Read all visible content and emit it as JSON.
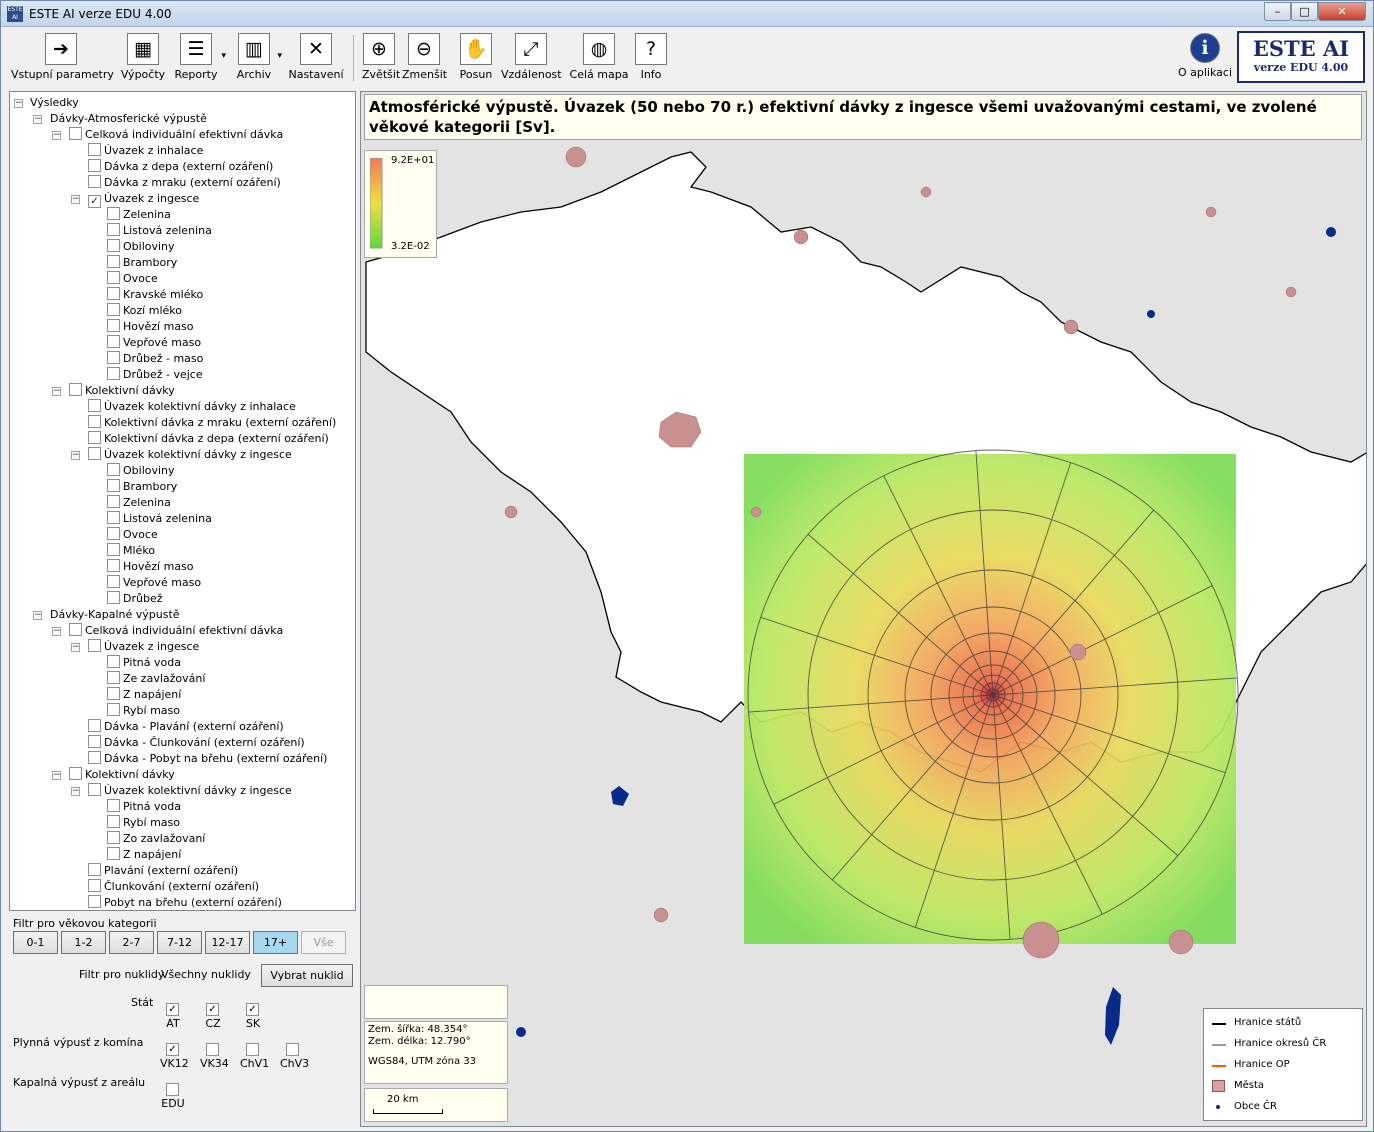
{
  "window": {
    "title": "ESTE AI verze EDU 4.00",
    "icon_text": "ESTE AI"
  },
  "toolbar": {
    "items": [
      {
        "label": "Vstupní parametry",
        "icon": "enter-icon",
        "glyph": "➔"
      },
      {
        "label": "Výpočty",
        "icon": "calculator-icon",
        "glyph": "▦"
      },
      {
        "label": "Reporty",
        "icon": "report-icon",
        "glyph": "☰"
      },
      {
        "label": "Archiv",
        "icon": "archive-icon",
        "glyph": "▥"
      },
      {
        "label": "Nastavení",
        "icon": "tools-icon",
        "glyph": "✕"
      },
      {
        "label": "Zvětšit",
        "icon": "zoom-in-icon",
        "glyph": "⊕"
      },
      {
        "label": "Zmenšit",
        "icon": "zoom-out-icon",
        "glyph": "⊖"
      },
      {
        "label": "Posun",
        "icon": "hand-icon",
        "glyph": "✋"
      },
      {
        "label": "Vzdálenost",
        "icon": "distance-icon",
        "glyph": "⤢"
      },
      {
        "label": "Celá mapa",
        "icon": "globe-icon",
        "glyph": "◍"
      },
      {
        "label": "Info",
        "icon": "info-map-icon",
        "glyph": "?"
      }
    ],
    "about_label": "O aplikaci",
    "brand_title": "ESTE AI",
    "brand_sub": "verze EDU 4.00"
  },
  "tree": {
    "items": [
      {
        "label": "Výsledky",
        "level": 0,
        "exp": "minus",
        "cb": false
      },
      {
        "label": "Dávky-Atmosferické výpustě",
        "level": 1,
        "exp": "minus",
        "cb": false
      },
      {
        "label": "Celková individuální efektivní dávka",
        "level": 2,
        "exp": "minus",
        "cb": true,
        "checked": false
      },
      {
        "label": "Úvazek z inhalace",
        "level": 3,
        "cb": true,
        "checked": false
      },
      {
        "label": "Dávka z depa (externí ozáření)",
        "level": 3,
        "cb": true,
        "checked": false
      },
      {
        "label": "Dávka z mraku (externí ozáření)",
        "level": 3,
        "cb": true,
        "checked": false
      },
      {
        "label": "Úvazek z ingesce",
        "level": 3,
        "exp": "minus",
        "cb": true,
        "checked": true
      },
      {
        "label": "Zelenina",
        "level": 4,
        "cb": true,
        "checked": false
      },
      {
        "label": "Listová zelenina",
        "level": 4,
        "cb": true,
        "checked": false
      },
      {
        "label": "Obiloviny",
        "level": 4,
        "cb": true,
        "checked": false
      },
      {
        "label": "Brambory",
        "level": 4,
        "cb": true,
        "checked": false
      },
      {
        "label": "Ovoce",
        "level": 4,
        "cb": true,
        "checked": false
      },
      {
        "label": "Kravské mléko",
        "level": 4,
        "cb": true,
        "checked": false
      },
      {
        "label": "Kozí mléko",
        "level": 4,
        "cb": true,
        "checked": false
      },
      {
        "label": "Hovězí maso",
        "level": 4,
        "cb": true,
        "checked": false
      },
      {
        "label": "Vepřové maso",
        "level": 4,
        "cb": true,
        "checked": false
      },
      {
        "label": "Drůbež - maso",
        "level": 4,
        "cb": true,
        "checked": false
      },
      {
        "label": "Drůbež - vejce",
        "level": 4,
        "cb": true,
        "checked": false
      },
      {
        "label": "Kolektivní dávky",
        "level": 2,
        "exp": "minus",
        "cb": true,
        "checked": false
      },
      {
        "label": "Úvazek kolektivní dávky z inhalace",
        "level": 3,
        "cb": true,
        "checked": false
      },
      {
        "label": "Kolektivní dávka z mraku (externí ozáření)",
        "level": 3,
        "cb": true,
        "checked": false
      },
      {
        "label": "Kolektivní dávka z depa (externí ozáření)",
        "level": 3,
        "cb": true,
        "checked": false
      },
      {
        "label": "Úvazek kolektivní dávky z ingesce",
        "level": 3,
        "exp": "minus",
        "cb": true,
        "checked": false
      },
      {
        "label": "Obiloviny",
        "level": 4,
        "cb": true,
        "checked": false
      },
      {
        "label": "Brambory",
        "level": 4,
        "cb": true,
        "checked": false
      },
      {
        "label": "Zelenina",
        "level": 4,
        "cb": true,
        "checked": false
      },
      {
        "label": "Listová zelenina",
        "level": 4,
        "cb": true,
        "checked": false
      },
      {
        "label": "Ovoce",
        "level": 4,
        "cb": true,
        "checked": false
      },
      {
        "label": "Mléko",
        "level": 4,
        "cb": true,
        "checked": false
      },
      {
        "label": "Hovězí maso",
        "level": 4,
        "cb": true,
        "checked": false
      },
      {
        "label": "Vepřové maso",
        "level": 4,
        "cb": true,
        "checked": false
      },
      {
        "label": "Drůbež",
        "level": 4,
        "cb": true,
        "checked": false
      },
      {
        "label": "Dávky-Kapalné výpustě",
        "level": 1,
        "exp": "minus",
        "cb": false
      },
      {
        "label": "Celková individuální efektivní dávka",
        "level": 2,
        "exp": "minus",
        "cb": true,
        "checked": false
      },
      {
        "label": "Úvazek z ingesce",
        "level": 3,
        "exp": "minus",
        "cb": true,
        "checked": false
      },
      {
        "label": "Pitná voda",
        "level": 4,
        "cb": true,
        "checked": false
      },
      {
        "label": "Ze zavlažování",
        "level": 4,
        "cb": true,
        "checked": false
      },
      {
        "label": "Z napájení",
        "level": 4,
        "cb": true,
        "checked": false
      },
      {
        "label": "Rybí maso",
        "level": 4,
        "cb": true,
        "checked": false
      },
      {
        "label": "Dávka - Plavání (externí ozáření)",
        "level": 3,
        "cb": true,
        "checked": false
      },
      {
        "label": "Dávka - Člunkování (externí ozáření)",
        "level": 3,
        "cb": true,
        "checked": false
      },
      {
        "label": "Dávka - Pobyt na břehu (externí ozáření)",
        "level": 3,
        "cb": true,
        "checked": false
      },
      {
        "label": "Kolektivní dávky",
        "level": 2,
        "exp": "minus",
        "cb": true,
        "checked": false
      },
      {
        "label": "Úvazek kolektivní dávky z ingesce",
        "level": 3,
        "exp": "minus",
        "cb": true,
        "checked": false
      },
      {
        "label": "Pitná voda",
        "level": 4,
        "cb": true,
        "checked": false
      },
      {
        "label": "Rybí maso",
        "level": 4,
        "cb": true,
        "checked": false
      },
      {
        "label": "Zo zavlažovaní",
        "level": 4,
        "cb": true,
        "checked": false
      },
      {
        "label": "Z napájení",
        "level": 4,
        "cb": true,
        "checked": false
      },
      {
        "label": "Plavání (externí ozáření)",
        "level": 3,
        "cb": true,
        "checked": false
      },
      {
        "label": "Člunkování (externí ozáření)",
        "level": 3,
        "cb": true,
        "checked": false
      },
      {
        "label": "Pobyt na břehu (externí ozáření)",
        "level": 3,
        "cb": true,
        "checked": false
      }
    ]
  },
  "filters": {
    "age_label": "Filtr pro věkovou kategorii",
    "ages": [
      {
        "label": "0-1",
        "state": "normal"
      },
      {
        "label": "1-2",
        "state": "normal"
      },
      {
        "label": "2-7",
        "state": "normal"
      },
      {
        "label": "7-12",
        "state": "normal"
      },
      {
        "label": "12-17",
        "state": "normal"
      },
      {
        "label": "17+",
        "state": "on"
      },
      {
        "label": "Vše",
        "state": "off"
      }
    ],
    "nuclide_label": "Filtr pro nuklidy",
    "nuclide_value": "Všechny nuklidy",
    "nuclide_button": "Vybrat nuklid",
    "state_label": "Stát",
    "states": [
      {
        "label": "AT",
        "checked": true
      },
      {
        "label": "CZ",
        "checked": true
      },
      {
        "label": "SK",
        "checked": true
      }
    ],
    "gas_label": "Plynná výpusť z komína",
    "gas": [
      {
        "label": "VK12",
        "checked": true
      },
      {
        "label": "VK34",
        "checked": false
      },
      {
        "label": "ChV1",
        "checked": false
      },
      {
        "label": "ChV3",
        "checked": false
      }
    ],
    "liquid_label": "Kapalná výpusť z areálu",
    "liquid": [
      {
        "label": "EDU",
        "checked": false
      }
    ]
  },
  "map": {
    "title": "Atmosférické výpustě. Úvazek (50 nebo 70 r.) efektivní dávky z ingesce všemi uvažovanými cestami, ve zvolené věkové kategorii [Sv].",
    "scale_max": "9.2E+01",
    "scale_min": "3.2E-02",
    "lat": "Zem. šířka: 48.354°",
    "lon": "Zem. délka: 12.790°",
    "crs": "WGS84, UTM zóna 33",
    "scale_bar": "20 km",
    "legend": [
      {
        "label": "Hranice států",
        "kind": "line",
        "color": "#000000"
      },
      {
        "label": "Hranice okresů ČR",
        "kind": "line",
        "color": "#9a9a9a"
      },
      {
        "label": "Hranice OP",
        "kind": "line",
        "color": "#ff5a00"
      },
      {
        "label": "Města",
        "kind": "box",
        "color": "#d9a0a0"
      },
      {
        "label": "Obce ČR",
        "kind": "dot",
        "color": "#1a237e"
      }
    ],
    "colors": {
      "high": "#e06040",
      "mid": "#f0e040",
      "low": "#60d840",
      "city": "#c99090",
      "water": "#0a2a8a"
    }
  }
}
